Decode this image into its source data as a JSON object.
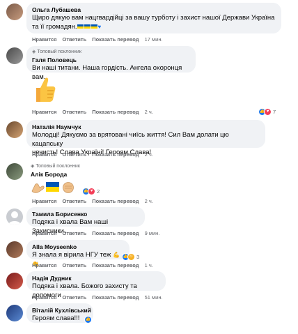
{
  "comments": [
    {
      "author": "Ольга Лубашева",
      "text_lines": [
        "Щиро дякую вам нацгвардійці за вашу турботу і захист нашої Держави Україна",
        "та її громадян."
      ],
      "actions": {
        "like": "Нравится",
        "reply": "Ответить",
        "show": "Показать перевод",
        "time": "17 мин."
      }
    },
    {
      "author": "Галя Половець",
      "badge": "Топовый поклонник",
      "text": "Ви наші титани. Наша гордість. Ангела охоронця вам.",
      "sticker": "thumbs-up-sticker",
      "actions": {
        "like": "Нравится",
        "reply": "Ответить",
        "show": "Показать перевод",
        "time": "2 ч."
      },
      "reaction_count": "7"
    },
    {
      "author": "Наталія Наумчук",
      "text_lines": [
        "Молодці! Дякуємо за врятовані чиїсь життя! Сил Вам долати цю кацапську",
        "нечисть! Слава Україні! Героям Слава!"
      ],
      "actions": {
        "like": "Нравится",
        "reply": "Ответить",
        "show": "Показать перевод",
        "time": "2 ч."
      }
    },
    {
      "author": "Алік Борода",
      "badge": "Топовый поклонник",
      "emoji": "muscle, ukraine-flag, fist",
      "actions": {
        "like": "Нравится",
        "reply": "Ответить",
        "show": "Показать перевод",
        "time": "2 ч."
      },
      "reaction_count": "2"
    },
    {
      "author": "Тамила Борисенко",
      "text": "Подяка і хвала Вам наші Захисники.",
      "actions": {
        "like": "Нравится",
        "reply": "Ответить",
        "show": "Показать перевод",
        "time": "9 мин."
      }
    },
    {
      "author": "Alla Moyseenko",
      "text": "Я знала я вірила НГУ теж",
      "actions": {
        "like": "Нравится",
        "reply": "Ответить",
        "show": "Показать перевод",
        "time": "1 ч."
      },
      "reaction_count": "3"
    },
    {
      "author": "Надія Дудник",
      "text": "Подяка і хвала. Божого захисту та допомоги",
      "actions": {
        "like": "Нравится",
        "reply": "Ответить",
        "show": "Показать перевод",
        "time": "51 мин."
      }
    },
    {
      "author": "Віталій Кухлівський",
      "text": "Героям слава!!!"
    }
  ],
  "colors": {
    "bubble": "#f0f2f5",
    "like": "#1877f2",
    "love": "#f33e58",
    "muted": "#65676b"
  }
}
